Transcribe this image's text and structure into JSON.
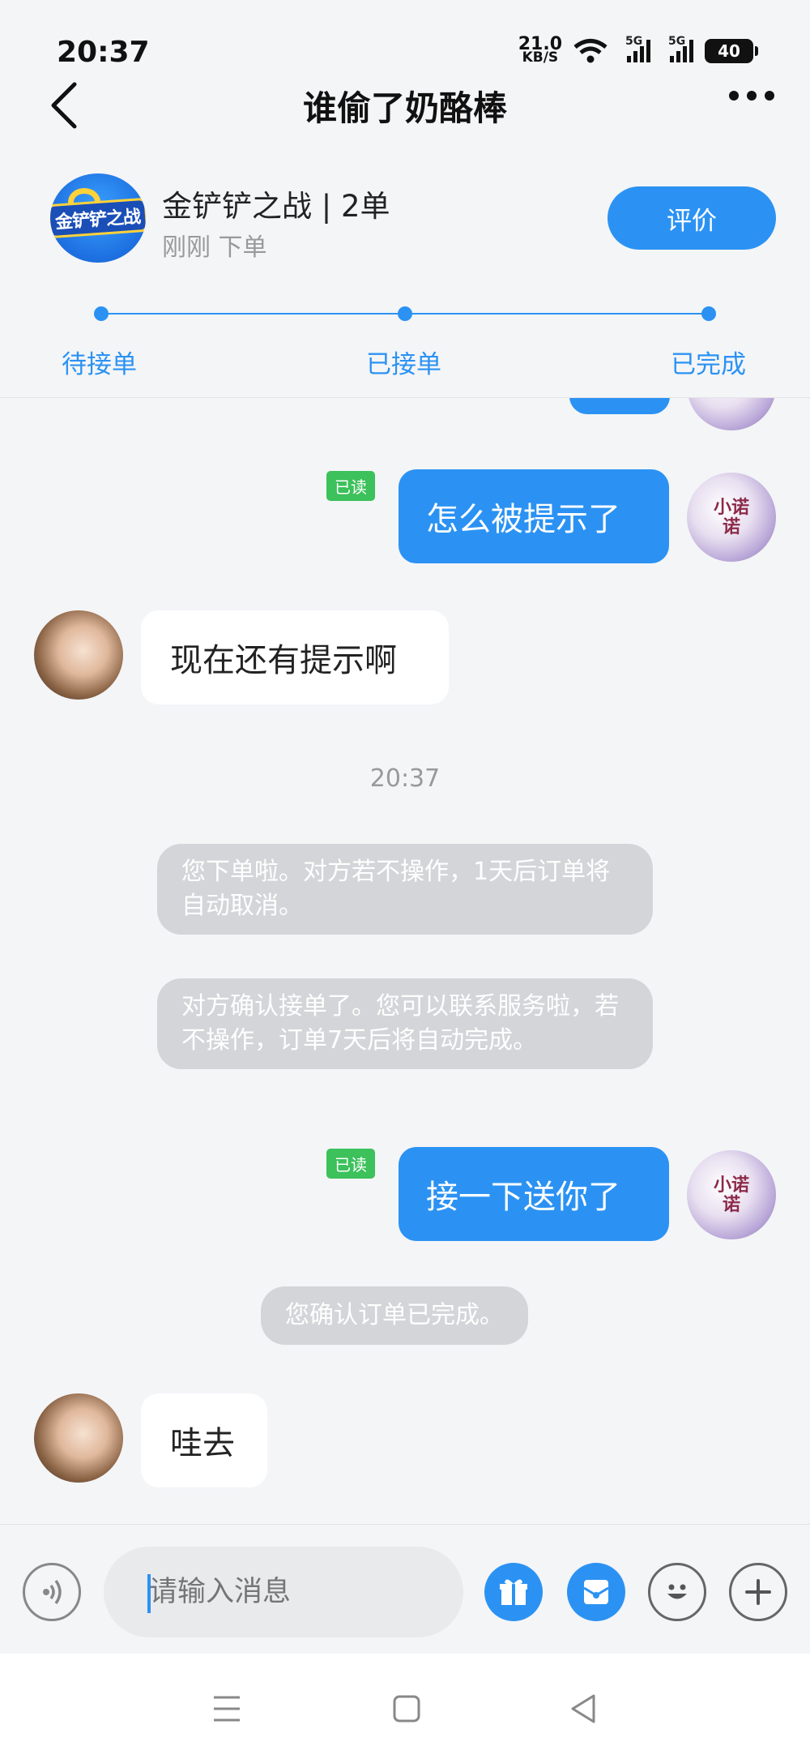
{
  "status_bar": {
    "time": "20:37",
    "net_speed_value": "21.0",
    "net_speed_unit": "KB/S",
    "signal_label": "5G",
    "battery": "40"
  },
  "header": {
    "title": "谁偷了奶酪棒"
  },
  "order": {
    "service_name": "金铲铲之战 | 2单",
    "time_label": "刚刚 下单",
    "rate_label": "评价",
    "logo_text": "金铲铲之战"
  },
  "progress": {
    "steps": [
      "待接单",
      "已接单",
      "已完成"
    ]
  },
  "my_avatar_text": "小诺诺",
  "chat": {
    "read_tag": "已读",
    "msg_me_1": "怎么被提示了",
    "msg_her_1": "现在还有提示啊",
    "timestamp": "20:37",
    "sys_1": "您下单啦。对方若不操作，1天后订单将自动取消。",
    "sys_2": "对方确认接单了。您可以联系服务啦，若不操作，订单7天后将自动完成。",
    "msg_me_2": "接一下送你了",
    "sys_3": "您确认订单已完成。",
    "msg_her_2": "哇去"
  },
  "input": {
    "placeholder": "请输入消息"
  },
  "colors": {
    "accent": "#2b92f3",
    "read_green": "#3cc15b",
    "system_bubble": "#d4d5d8"
  }
}
